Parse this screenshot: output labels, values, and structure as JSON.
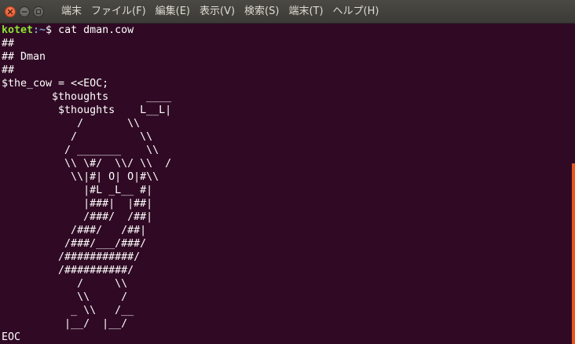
{
  "menu": {
    "items": [
      {
        "name": "menu-terminal-title",
        "label": "端末"
      },
      {
        "name": "menu-file",
        "label": "ファイル(F)"
      },
      {
        "name": "menu-edit",
        "label": "編集(E)"
      },
      {
        "name": "menu-view",
        "label": "表示(V)"
      },
      {
        "name": "menu-search",
        "label": "検索(S)"
      },
      {
        "name": "menu-terminal",
        "label": "端末(T)"
      },
      {
        "name": "menu-help",
        "label": "ヘルプ(H)"
      }
    ]
  },
  "window_controls": {
    "close_icon": "close-icon",
    "minimize_icon": "minimize-icon",
    "maximize_icon": "maximize-icon"
  },
  "terminal": {
    "prompt": {
      "user": "kotet",
      "path": ":~",
      "symbol": "$ ",
      "command": "cat dman.cow"
    },
    "output_lines": [
      "##",
      "## Dman",
      "##",
      "$the_cow = <<EOC;",
      "        $thoughts      ____",
      "         $thoughts    L__L|",
      "            /       \\\\",
      "           /          \\\\",
      "          / _______    \\\\",
      "          \\\\ \\#/  \\\\/ \\\\  /",
      "           \\\\|#| O| O|#\\\\",
      "             |#L _L__ #|",
      "             |###|  |##|",
      "             /###/  /##|",
      "           /###/   /##|",
      "          /###/___/###/",
      "         /###########/",
      "         /##########/",
      "            /     \\\\",
      "            \\\\     /",
      "           _ \\\\   /__",
      "          |__/  |__/",
      "EOC"
    ]
  },
  "colors": {
    "background": "#300a24",
    "titlebar": "#3c3b37",
    "prompt_user": "#8ae234",
    "prompt_path": "#729fcf",
    "text": "#ffffff",
    "scrollbar": "#e95420"
  }
}
